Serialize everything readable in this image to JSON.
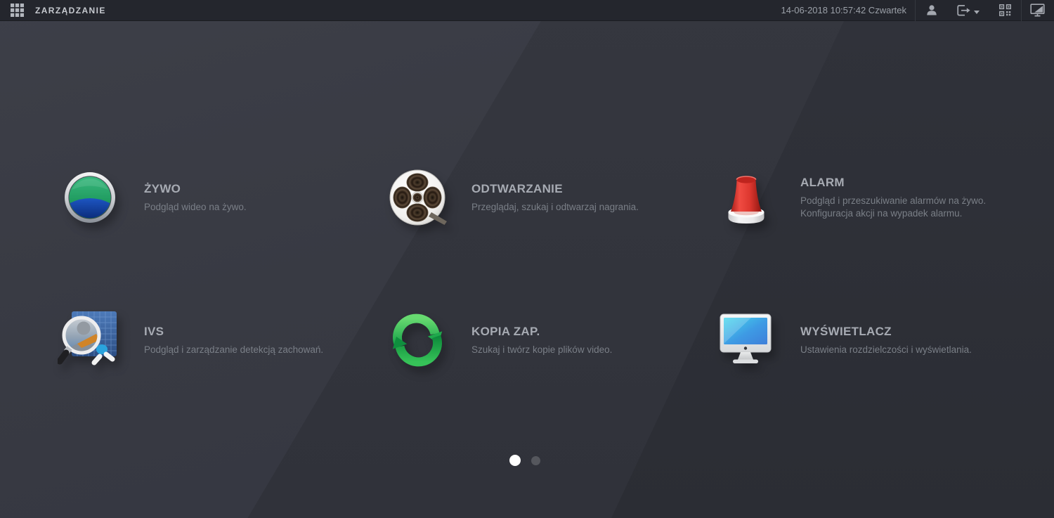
{
  "header": {
    "title": "ZARZĄDZANIE",
    "datetime": "14-06-2018 10:57:42 Czwartek",
    "icons": {
      "apps_grid": "apps-grid-icon",
      "user": "user-icon",
      "logout": "logout-icon",
      "logout_caret": "chevron-down-icon",
      "qr": "qr-code-icon",
      "display_mode": "display-mode-icon"
    }
  },
  "tiles": [
    {
      "title": "ŻYWO",
      "desc": "Podgląd wideo na żywo.",
      "icon": "live-view-lens-icon"
    },
    {
      "title": "ODTWARZANIE",
      "desc": "Przeglądaj, szukaj i odtwarzaj nagrania.",
      "icon": "film-reel-icon"
    },
    {
      "title": "ALARM",
      "desc": "Podgląd i przeszukiwanie alarmów na żywo.",
      "desc2": "Konfiguracja akcji na wypadek alarmu.",
      "icon": "alarm-siren-icon"
    },
    {
      "title": "IVS",
      "desc": "Podgląd i zarządzanie detekcją zachowań.",
      "icon": "ivs-magnifier-icon"
    },
    {
      "title": "KOPIA ZAP.",
      "desc": "Szukaj i twórz kopie plików video.",
      "icon": "backup-sync-icon"
    },
    {
      "title": "WYŚWIETLACZ",
      "desc": "Ustawienia rozdzielczości i wyświetlania.",
      "icon": "display-monitor-icon"
    }
  ],
  "pagination": {
    "total_pages": 2,
    "active_page": 1
  },
  "colors": {
    "header_bg": "#24262d",
    "bg_left": "#3b3d46",
    "bg_mid": "#34363e",
    "bg_right": "#2e3037",
    "title_text": "#a7abb3",
    "desc_text": "#7a7f87",
    "dot_active": "#ffffff",
    "dot_inactive": "#55575d",
    "alarm_red": "#e03a32",
    "backup_green": "#2fbf52",
    "screen_blue": "#3f9ae4",
    "live_green": "#27a468",
    "live_blue": "#16439f"
  }
}
